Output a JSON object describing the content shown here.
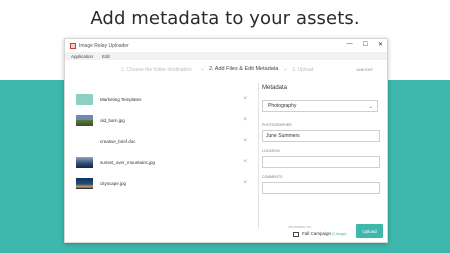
{
  "headline": "Add metadata to your assets.",
  "window": {
    "title": "Image Relay Uploader",
    "controls": {
      "minimize": "—",
      "maximize": "☐",
      "close": "✕"
    }
  },
  "menu": [
    "Application",
    "Edit"
  ],
  "steps": {
    "step1": "1. Choose the folder destination",
    "step2": "2. Add Files & Edit Metadata",
    "step3": "3. Upload",
    "separator": "»",
    "exit": "LINK EXIT"
  },
  "files": [
    {
      "name": "Marketing Templates",
      "thumb": "folder-icon"
    },
    {
      "name": "old_barn.jpg",
      "thumb": "image-thumbnail"
    },
    {
      "name": "creative_brief.doc",
      "thumb": "document-icon"
    },
    {
      "name": "sunset_over_mountains.jpg",
      "thumb": "image-thumbnail"
    },
    {
      "name": "cityscape.jpg",
      "thumb": "image-thumbnail"
    }
  ],
  "remove_glyph": "×",
  "metadata": {
    "heading": "Metadata",
    "template_value": "Photography",
    "fields": [
      {
        "label": "PHOTOGRAPHER",
        "value": "June Summers"
      },
      {
        "label": "LOCATION",
        "value": ""
      },
      {
        "label": "COMMENTS",
        "value": ""
      }
    ]
  },
  "footer": {
    "upload_to_label": "UPLOADING TO:",
    "campaign": "Fall Campaign",
    "change": "(Change)",
    "upload_button": "Upload"
  },
  "colors": {
    "accent": "#3eb8ac",
    "heading_text": "#2a2a2a"
  }
}
